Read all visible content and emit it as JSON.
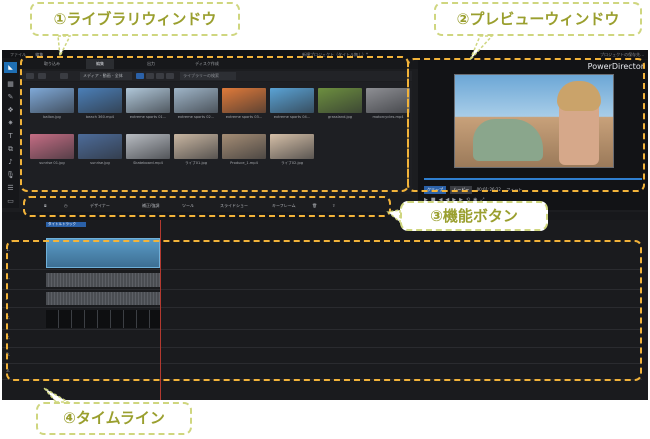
{
  "menubar": {
    "items": [
      "ファイル",
      "編集"
    ],
    "title": "新規プロジェクト（タイトル無し）*",
    "right": "プロジェクトの保存先..."
  },
  "modes": [
    "取り込み",
    "編集",
    "出力",
    "ディスク作成"
  ],
  "library": {
    "dropdown": "メディア - 動画 - 全体",
    "search": "ライブラリーの検索",
    "items": [
      {
        "label": "ballon.jpg",
        "color": "#7fa9d8"
      },
      {
        "label": "beach 360.mp4",
        "color": "#4b7fb8"
      },
      {
        "label": "extreme sports 01...",
        "color": "#b0c7d9"
      },
      {
        "label": "extreme sports 02...",
        "color": "#9fb5c8"
      },
      {
        "label": "extreme sports 03...",
        "color": "#e07a3a"
      },
      {
        "label": "extreme sports 04...",
        "color": "#5aa3d6"
      },
      {
        "label": "grassland.jpg",
        "color": "#6d8f3f"
      },
      {
        "label": "motorcycles.mp4",
        "color": "#8e8f94"
      },
      {
        "label": "sunrise 01.jpg",
        "color": "#c56d84"
      },
      {
        "label": "sunrise.jpg",
        "color": "#4d6c9a"
      },
      {
        "label": "Skateboard.mp4",
        "color": "#b8bcc2"
      },
      {
        "label": "ライブ01.jpg",
        "color": "#c9b6a1"
      },
      {
        "label": "Produce_1.mp4",
        "color": "#a58d75"
      },
      {
        "label": "ライブ02.jpg",
        "color": "#d5bfa7"
      }
    ]
  },
  "preview": {
    "brand": "PowerDirector",
    "btn_clip": "クリップ",
    "btn_movie": "ムービー",
    "timecode": "00:01:26:22",
    "mode": "フィット"
  },
  "functions": [
    "デザイナー",
    "補正/強調",
    "ツール",
    "スライドショー",
    "キーフレーム"
  ],
  "timeline": {
    "tag": "タイトルトラック",
    "tracks": [
      "1.",
      "1.",
      "",
      "2.",
      "2.",
      "3.",
      "3."
    ]
  },
  "annotations": {
    "library": "①ライブラリウィンドウ",
    "preview": "②プレビューウィンドウ",
    "buttons": "③機能ボタン",
    "timeline": "④タイムライン"
  },
  "colors": {
    "accent": "#f2b33a",
    "callout_border": "#cfd67f",
    "callout_text": "#9a9f2e",
    "app_bg": "#1c1d20",
    "brand_blue": "#2b61a8"
  }
}
